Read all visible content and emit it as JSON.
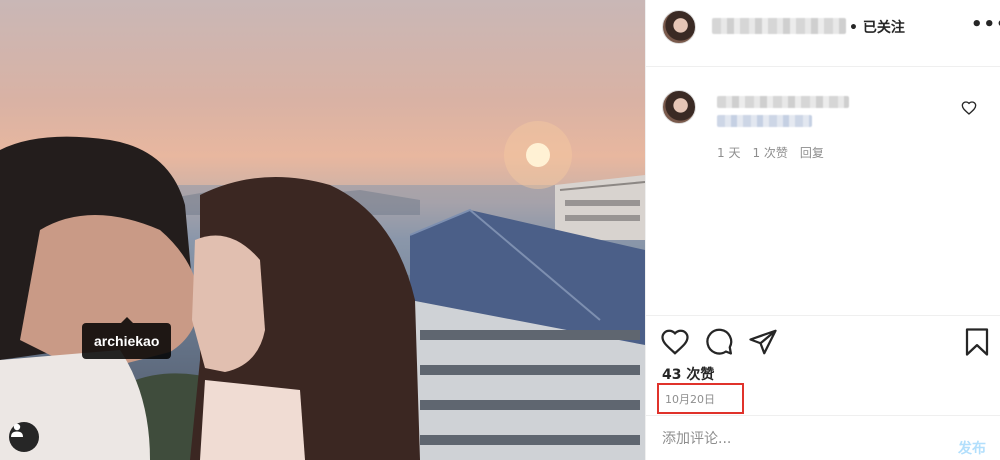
{
  "photo": {
    "tag_label": "archiekao"
  },
  "header": {
    "follow_status": "• 已关注",
    "more_label": "•••"
  },
  "comment": {
    "age": "1 天",
    "likes": "1 次赞",
    "reply": "回复"
  },
  "post": {
    "likes_count": "43 次赞",
    "date": "10月20日"
  },
  "add_comment": {
    "placeholder": "添加评论...",
    "post_label": "发布"
  },
  "colors": {
    "accent_blue": "#b2dffc",
    "highlight_red": "#e0322b",
    "muted_text": "#8e8e8e"
  },
  "icons": [
    "user-icon",
    "heart-icon",
    "comment-icon",
    "share-icon",
    "bookmark-icon",
    "more-icon"
  ]
}
